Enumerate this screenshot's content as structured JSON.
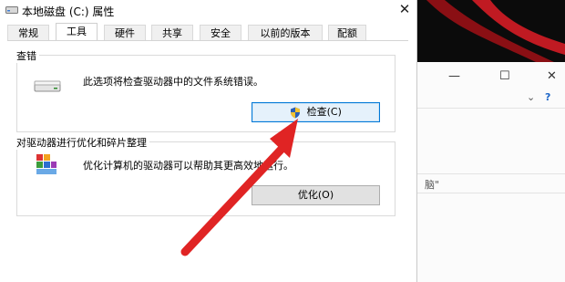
{
  "dialog": {
    "title": "本地磁盘 (C:) 属性",
    "close_glyph": "✕",
    "tabs": [
      "常规",
      "工具",
      "硬件",
      "共享",
      "安全",
      "以前的版本",
      "配额"
    ],
    "active_tab": "工具",
    "check_group": {
      "title": "查错",
      "description": "此选项将检查驱动器中的文件系统错误。",
      "button": "检查(C)"
    },
    "optimize_group": {
      "title": "对驱动器进行优化和碎片整理",
      "description": "优化计算机的驱动器可以帮助其更高效地运行。",
      "button": "优化(O)"
    }
  },
  "background_window": {
    "minimize": "—",
    "maximize": "☐",
    "close": "✕",
    "partial_text": "脑\"",
    "chevron": "⌄",
    "help": "?"
  },
  "colors": {
    "accent": "#0078d7",
    "arrow": "#e02424"
  }
}
